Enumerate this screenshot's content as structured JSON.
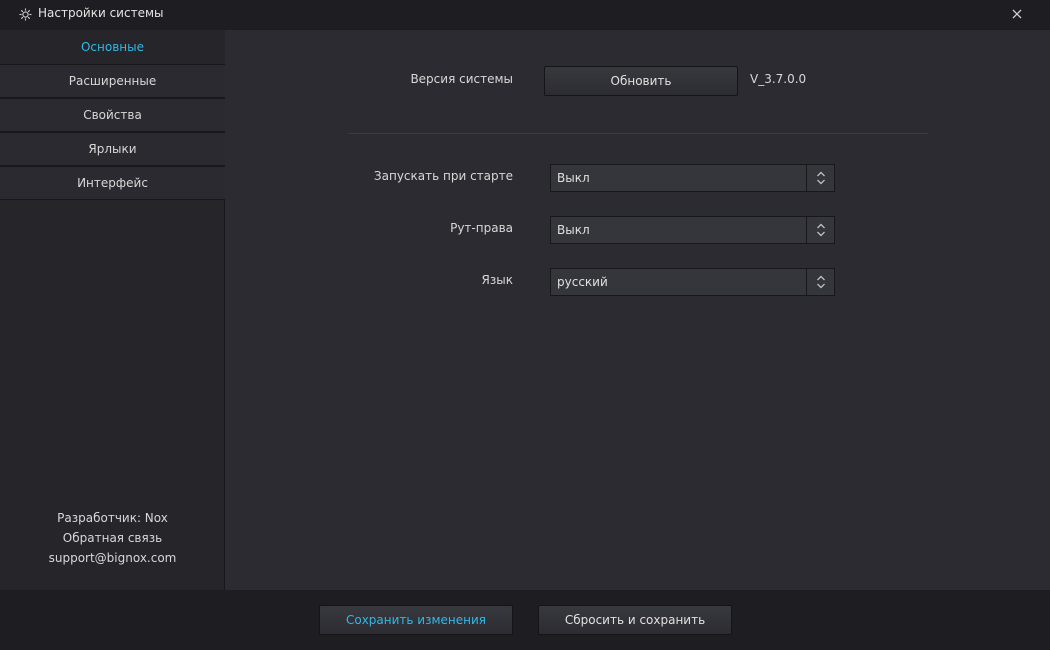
{
  "window": {
    "title": "Настройки системы",
    "icon": "gear-icon",
    "close_icon": "close-icon"
  },
  "sidebar": {
    "items": [
      {
        "label": "Основные",
        "active": true
      },
      {
        "label": "Расширенные",
        "active": false
      },
      {
        "label": "Свойства",
        "active": false
      },
      {
        "label": "Ярлыки",
        "active": false
      },
      {
        "label": "Интерфейс",
        "active": false
      }
    ],
    "footer": {
      "developer": "Разработчик: Nox",
      "feedback": "Обратная связь",
      "email": "support@bignox.com"
    }
  },
  "main": {
    "version": {
      "label": "Версия системы",
      "update_button": "Обновить",
      "value": "V_3.7.0.0"
    },
    "settings": [
      {
        "label": "Запускать при старте",
        "value": "Выкл"
      },
      {
        "label": "Рут-права",
        "value": "Выкл"
      },
      {
        "label": "Язык",
        "value": "русский"
      }
    ]
  },
  "footer": {
    "save_button": "Сохранить изменения",
    "reset_button": "Сбросить и сохранить"
  },
  "colors": {
    "accent": "#2eb9e8",
    "background": "#2b2b31",
    "titlebar": "#1e1e22"
  }
}
